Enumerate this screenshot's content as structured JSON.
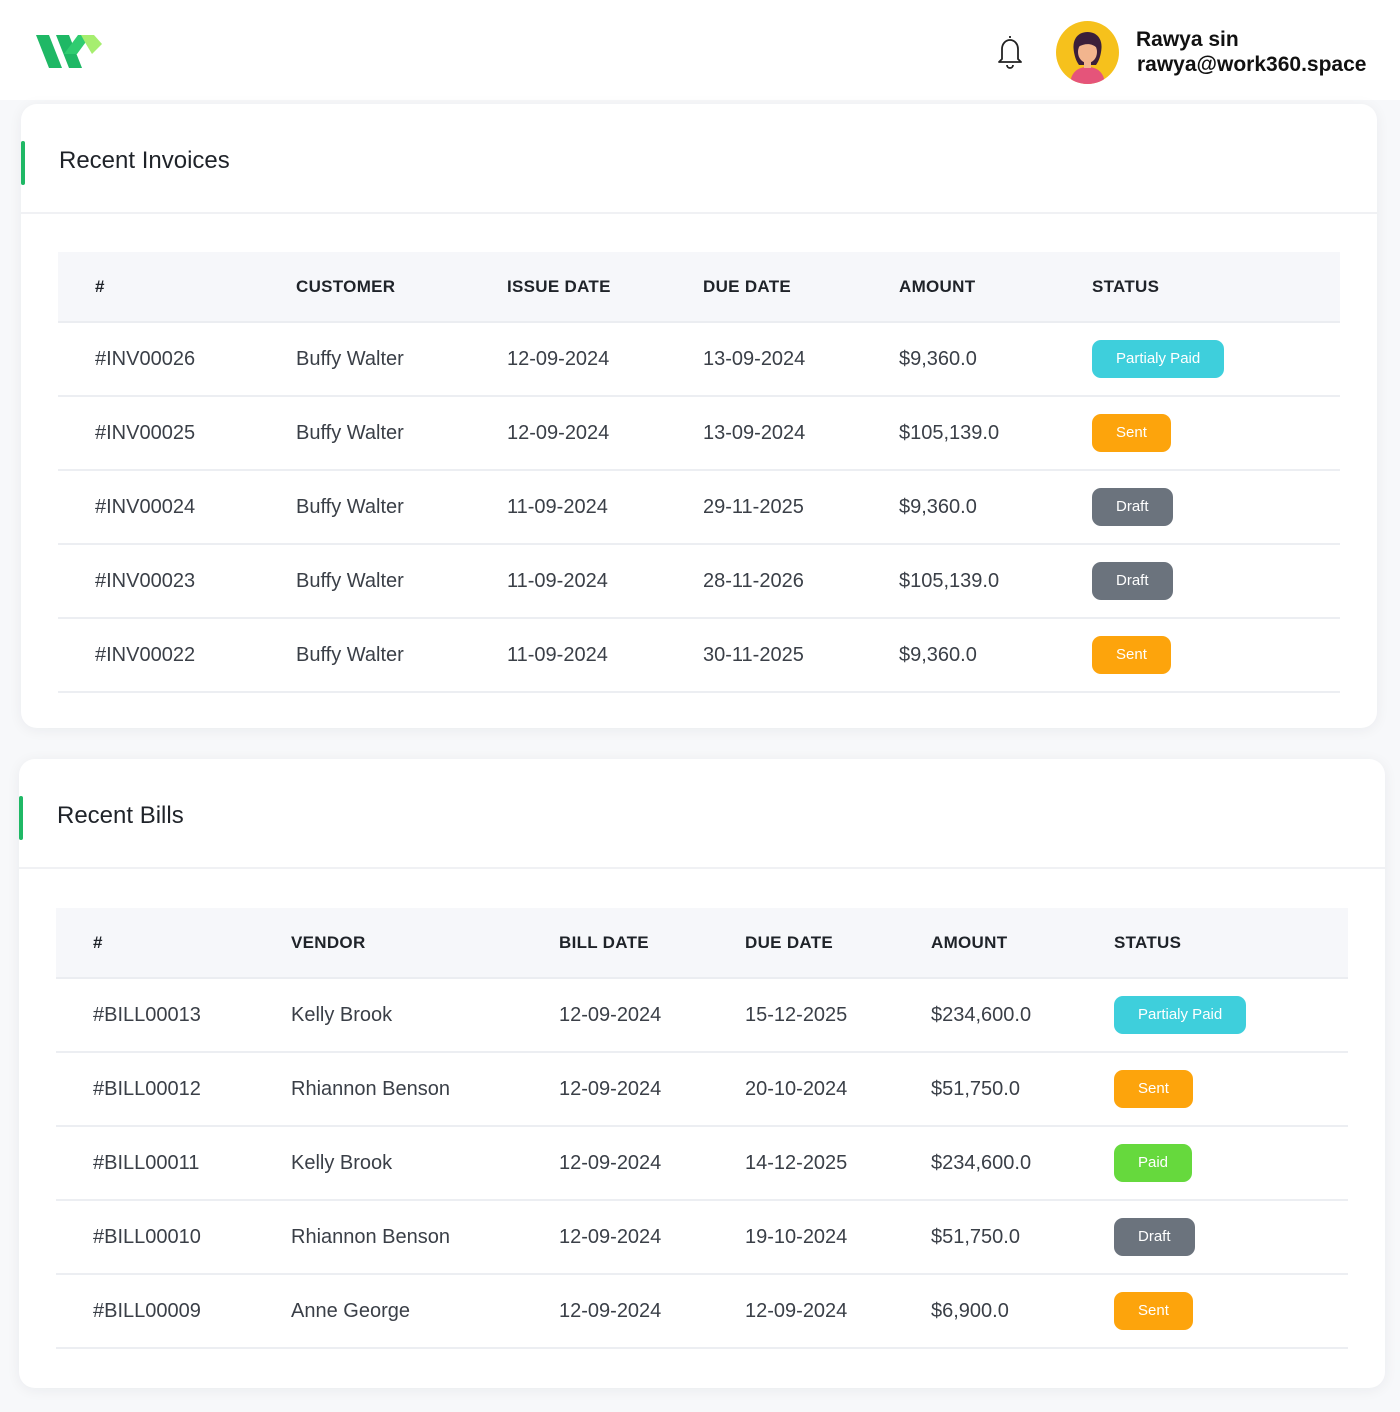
{
  "user": {
    "name": "Rawya sin",
    "email": "rawya@work360.space"
  },
  "icons": {
    "logo": "work360-logo",
    "notifications": "bell-icon",
    "avatar": "user-avatar"
  },
  "colors": {
    "accent": "#1fb865",
    "partial": "#3ecfdc",
    "sent": "#fda40c",
    "draft": "#6b737d",
    "paid": "#66d93d"
  },
  "invoices": {
    "title": "Recent Invoices",
    "columns": [
      "#",
      "CUSTOMER",
      "ISSUE DATE",
      "DUE DATE",
      "AMOUNT",
      "STATUS"
    ],
    "rows": [
      {
        "id": "#INV00026",
        "customer": "Buffy Walter",
        "issue_date": "12-09-2024",
        "due_date": "13-09-2024",
        "amount": "$9,360.0",
        "status": "Partialy Paid",
        "status_kind": "partial"
      },
      {
        "id": "#INV00025",
        "customer": "Buffy Walter",
        "issue_date": "12-09-2024",
        "due_date": "13-09-2024",
        "amount": "$105,139.0",
        "status": "Sent",
        "status_kind": "sent"
      },
      {
        "id": "#INV00024",
        "customer": "Buffy Walter",
        "issue_date": "11-09-2024",
        "due_date": "29-11-2025",
        "amount": "$9,360.0",
        "status": "Draft",
        "status_kind": "draft"
      },
      {
        "id": "#INV00023",
        "customer": "Buffy Walter",
        "issue_date": "11-09-2024",
        "due_date": "28-11-2026",
        "amount": "$105,139.0",
        "status": "Draft",
        "status_kind": "draft"
      },
      {
        "id": "#INV00022",
        "customer": "Buffy Walter",
        "issue_date": "11-09-2024",
        "due_date": "30-11-2025",
        "amount": "$9,360.0",
        "status": "Sent",
        "status_kind": "sent"
      }
    ]
  },
  "bills": {
    "title": "Recent Bills",
    "columns": [
      "#",
      "VENDOR",
      "BILL DATE",
      "DUE DATE",
      "AMOUNT",
      "STATUS"
    ],
    "rows": [
      {
        "id": "#BILL00013",
        "vendor": "Kelly Brook",
        "bill_date": "12-09-2024",
        "due_date": "15-12-2025",
        "amount": "$234,600.0",
        "status": "Partialy Paid",
        "status_kind": "partial"
      },
      {
        "id": "#BILL00012",
        "vendor": "Rhiannon Benson",
        "bill_date": "12-09-2024",
        "due_date": "20-10-2024",
        "amount": "$51,750.0",
        "status": "Sent",
        "status_kind": "sent"
      },
      {
        "id": "#BILL00011",
        "vendor": "Kelly Brook",
        "bill_date": "12-09-2024",
        "due_date": "14-12-2025",
        "amount": "$234,600.0",
        "status": "Paid",
        "status_kind": "paid"
      },
      {
        "id": "#BILL00010",
        "vendor": "Rhiannon Benson",
        "bill_date": "12-09-2024",
        "due_date": "19-10-2024",
        "amount": "$51,750.0",
        "status": "Draft",
        "status_kind": "draft"
      },
      {
        "id": "#BILL00009",
        "vendor": "Anne George",
        "bill_date": "12-09-2024",
        "due_date": "12-09-2024",
        "amount": "$6,900.0",
        "status": "Sent",
        "status_kind": "sent"
      }
    ]
  }
}
